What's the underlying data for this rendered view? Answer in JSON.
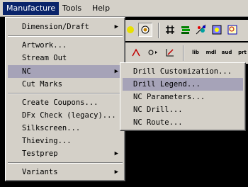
{
  "menubar": [
    {
      "label": "Manufacture",
      "active": true
    },
    {
      "label": "Tools",
      "active": false
    },
    {
      "label": "Help",
      "active": false
    }
  ],
  "toolbar": {
    "row2_labels": [
      "lib",
      "mdl",
      "aud",
      "prt"
    ]
  },
  "manufacture_menu": {
    "groups": [
      [
        {
          "label": "Dimension/Draft",
          "submenu": true
        }
      ],
      [
        {
          "label": "Artwork...",
          "submenu": false
        },
        {
          "label": "Stream Out",
          "submenu": false
        },
        {
          "label": "NC",
          "submenu": true,
          "highlighted": true
        },
        {
          "label": "Cut Marks",
          "submenu": false
        }
      ],
      [
        {
          "label": "Create Coupons...",
          "submenu": false
        },
        {
          "label": "DFx Check (legacy)...",
          "submenu": false
        },
        {
          "label": "Silkscreen...",
          "submenu": false
        },
        {
          "label": "Thieving...",
          "submenu": false
        },
        {
          "label": "Testprep",
          "submenu": true
        }
      ],
      [
        {
          "label": "Variants",
          "submenu": true
        }
      ]
    ]
  },
  "nc_submenu": {
    "items": [
      {
        "label": "Drill Customization...",
        "highlighted": false
      },
      {
        "label": "Drill Legend...",
        "highlighted": true
      },
      {
        "label": "NC Parameters...",
        "highlighted": false
      },
      {
        "label": "NC Drill...",
        "highlighted": false
      },
      {
        "label": "NC Route...",
        "highlighted": false
      }
    ]
  }
}
